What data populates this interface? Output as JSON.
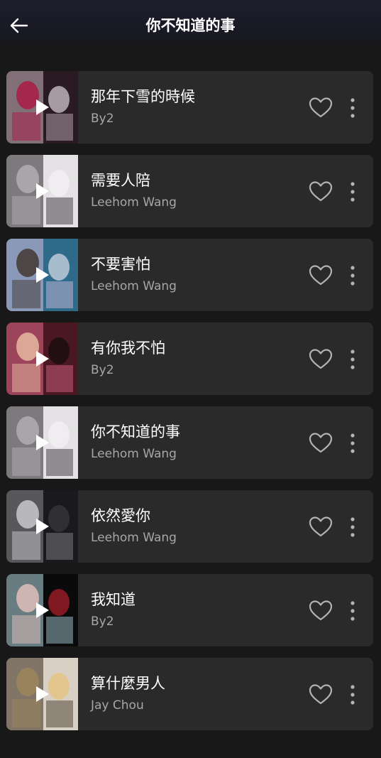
{
  "header": {
    "title": "你不知道的事",
    "back_icon": "arrow-left-icon"
  },
  "colors": {
    "background": "#181818",
    "card": "#2a2a2a",
    "title_text": "#ffffff",
    "artist_text": "#a7a7a7",
    "icon": "#b3b3b3"
  },
  "songs": [
    {
      "title": "那年下雪的時候",
      "artist": "By2",
      "palette": [
        "#2a1a22",
        "#c8b8c0",
        "#b01040",
        "#e8e0e6"
      ]
    },
    {
      "title": "需要人陪",
      "artist": "Leehom Wang",
      "palette": [
        "#e4e2e4",
        "#2a2228",
        "#b8b4b8",
        "#f4f2f4"
      ]
    },
    {
      "title": "不要害怕",
      "artist": "Leehom Wang",
      "palette": [
        "#2e6a8a",
        "#d8c0e0",
        "#3a2a22",
        "#e8e8f0"
      ]
    },
    {
      "title": "有你我不怕",
      "artist": "By2",
      "palette": [
        "#4a1820",
        "#e06a8a",
        "#f2c8a8",
        "#0a0a0a"
      ]
    },
    {
      "title": "你不知道的事",
      "artist": "Leehom Wang",
      "palette": [
        "#e4e2e4",
        "#2a2228",
        "#b8b4b8",
        "#f4f2f4"
      ]
    },
    {
      "title": "依然愛你",
      "artist": "Leehom Wang",
      "palette": [
        "#1a1a1e",
        "#8a8a90",
        "#d8d8dc",
        "#3a3a40"
      ]
    },
    {
      "title": "我知道",
      "artist": "By2",
      "palette": [
        "#0a0a0a",
        "#b4dce6",
        "#f0c8c0",
        "#c02030"
      ]
    },
    {
      "title": "算什麼男人",
      "artist": "Jay Chou",
      "palette": [
        "#d8d0c4",
        "#3a2a1e",
        "#a0885a",
        "#e8c070"
      ]
    }
  ]
}
